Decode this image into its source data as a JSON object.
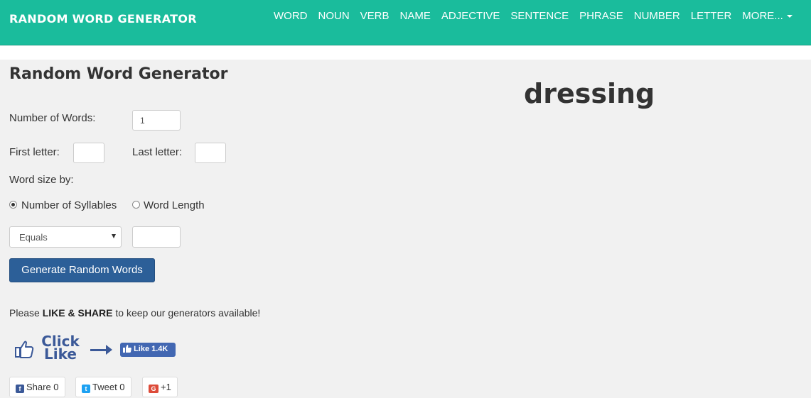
{
  "brand": "RANDOM WORD GENERATOR",
  "nav": {
    "items": [
      "WORD",
      "NOUN",
      "VERB",
      "NAME",
      "ADJECTIVE",
      "SENTENCE",
      "PHRASE",
      "NUMBER",
      "LETTER"
    ],
    "more": "MORE..."
  },
  "form": {
    "title": "Random Word Generator",
    "num_words_label": "Number of Words:",
    "num_words_value": "1",
    "first_letter_label": "First letter:",
    "last_letter_label": "Last letter:",
    "word_size_label": "Word size by:",
    "radio_syllables": "Number of Syllables",
    "radio_length": "Word Length",
    "selected_size_mode": "Number of Syllables",
    "comparison_select": "Equals",
    "generate_button": "Generate Random Words"
  },
  "result": {
    "word": "dressing"
  },
  "share": {
    "note_prefix": "Please ",
    "note_bold": "LIKE & SHARE",
    "note_suffix": " to keep our generators available!",
    "click": "Click",
    "like": "Like",
    "fb_like": "Like 1.4K",
    "share_btn": "Share 0",
    "tweet_btn": "Tweet 0",
    "gplus_btn": "+1"
  },
  "colors": {
    "nav_bg": "#1abc9c",
    "button_bg": "#2c5f98",
    "facebook": "#3b5998"
  },
  "icons": [
    "thumbs-up-icon",
    "arrow-right-icon",
    "facebook-icon",
    "twitter-icon",
    "google-plus-icon",
    "caret-down-icon"
  ]
}
